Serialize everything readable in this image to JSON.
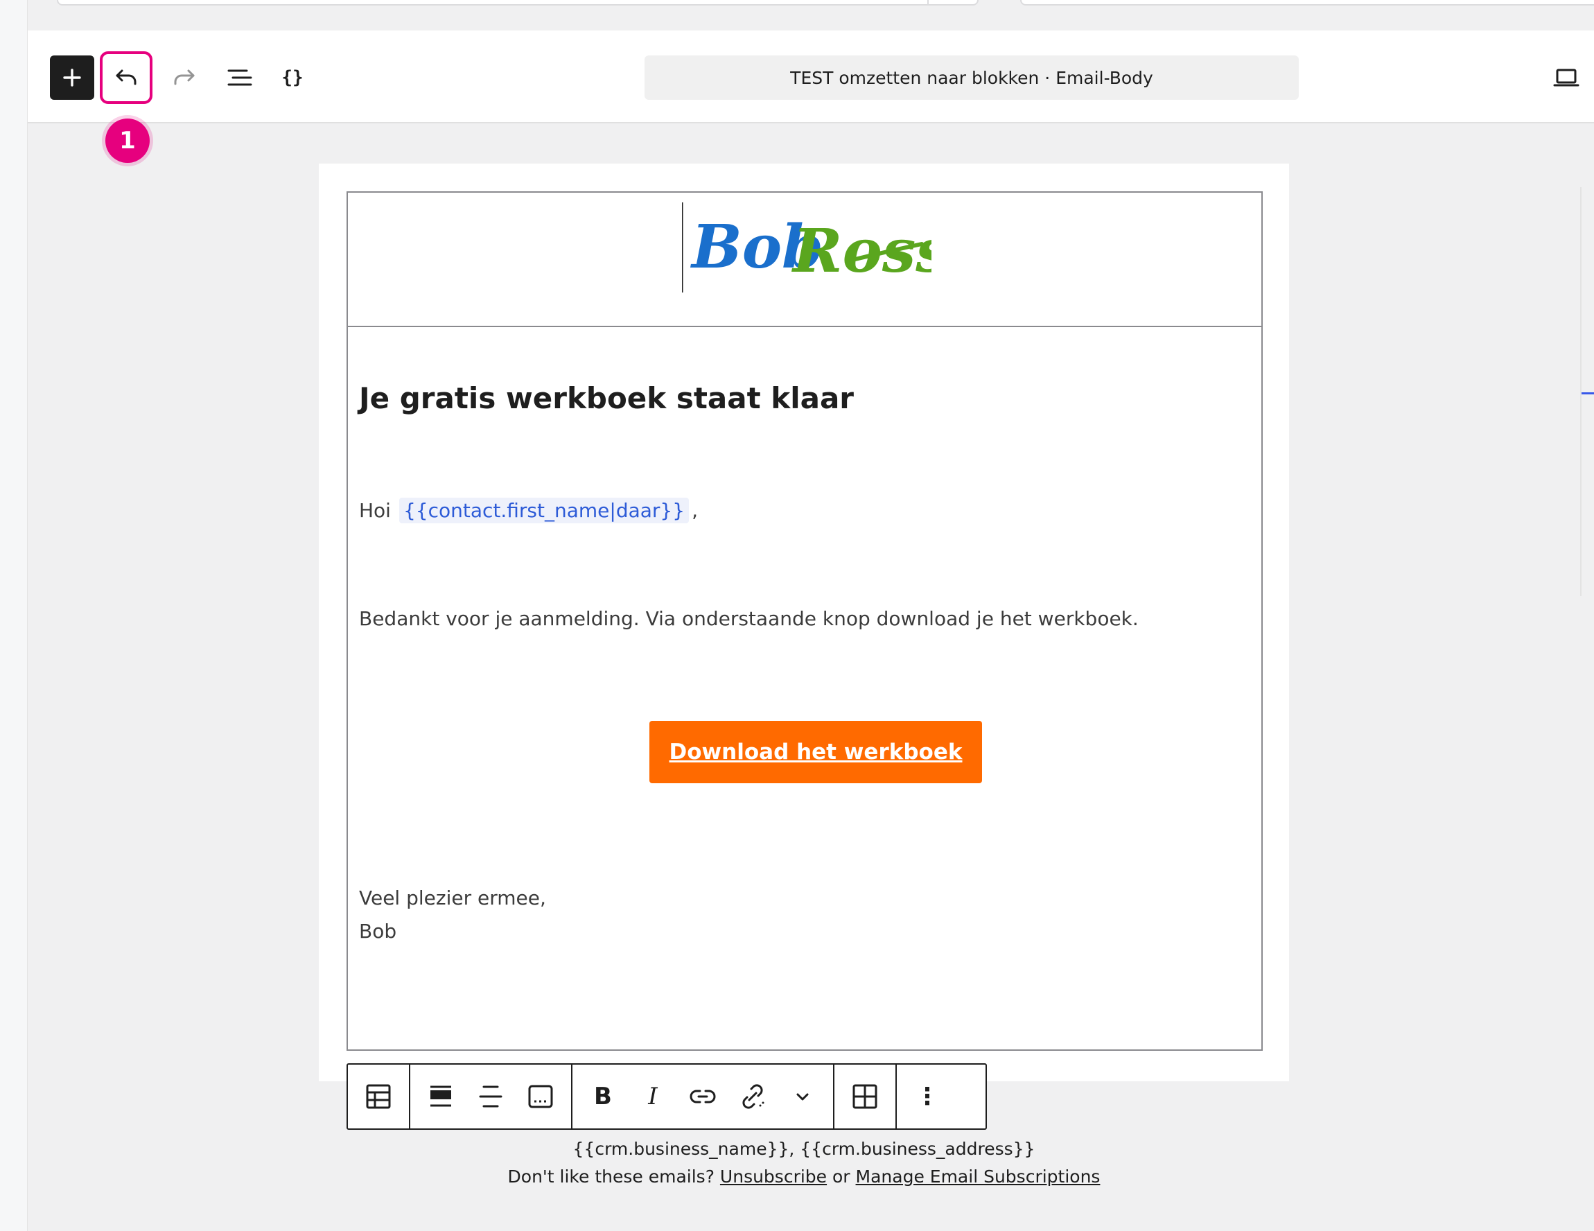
{
  "toolbar": {
    "document_title": "TEST omzetten naar blokken · Email-Body",
    "code_label": "{}",
    "icons": {
      "add": "plus-icon",
      "undo": "undo-icon",
      "redo": "redo-icon",
      "list_view": "list-view-icon",
      "code": "code-braces-icon",
      "device": "laptop-icon"
    }
  },
  "annotation": {
    "step_number": "1",
    "color": "#e6007e"
  },
  "email": {
    "logo": {
      "first": "Bob",
      "second": "Ross",
      "colors": {
        "first": "#1a6fcc",
        "second": "#5aa61e"
      }
    },
    "heading": "Je gratis werkboek staat klaar",
    "greeting_prefix": "Hoi",
    "merge_tag": "{{contact.first_name|daar}}",
    "greeting_suffix": ",",
    "intro": "Bedankt voor je aanmelding. Via onderstaande knop download je het werkboek.",
    "cta_label": "Download het werkboek",
    "cta_color": "#ff6a00",
    "closing_line1": "Veel plezier ermee,",
    "closing_line2": "Bob"
  },
  "block_toolbar": {
    "icons": [
      "table-icon",
      "align-top-icon",
      "align-middle-icon",
      "caption-icon",
      "bold-icon",
      "italic-icon",
      "link-icon",
      "unlink-icon",
      "chevron-down-icon",
      "grid-icon",
      "more-options-icon"
    ],
    "bold_label": "B",
    "italic_label": "I",
    "more_label": "⋮"
  },
  "footer": {
    "business_line": "{{crm.business_name}}, {{crm.business_address}}",
    "prompt": "Don't like these emails? ",
    "unsubscribe": "Unsubscribe",
    "or": " or ",
    "manage": "Manage Email Subscriptions"
  }
}
